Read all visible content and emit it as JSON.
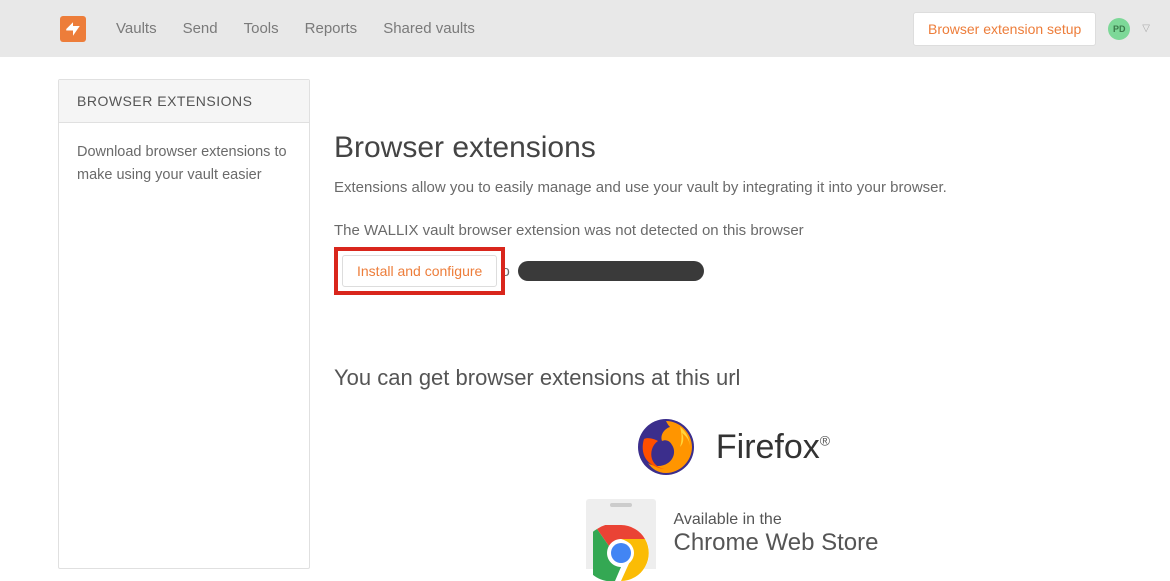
{
  "topbar": {
    "nav": [
      "Vaults",
      "Send",
      "Tools",
      "Reports",
      "Shared vaults"
    ],
    "ext_setup": "Browser extension setup",
    "avatar_initials": "PD"
  },
  "sidebar": {
    "header": "BROWSER EXTENSIONS",
    "body": "Download browser extensions to make using your vault easier"
  },
  "main": {
    "title": "Browser extensions",
    "subtitle": "Extensions allow you to easily manage and use your vault by integrating it into your browser.",
    "detect_line": "The WALLIX vault browser extension was not detected on this browser",
    "install_label": "Install and configure",
    "to_word": "to",
    "url_heading": "You can get browser extensions at this url",
    "firefox_label": "Firefox",
    "chrome_line1": "Available in the",
    "chrome_line2": "Chrome Web Store"
  }
}
